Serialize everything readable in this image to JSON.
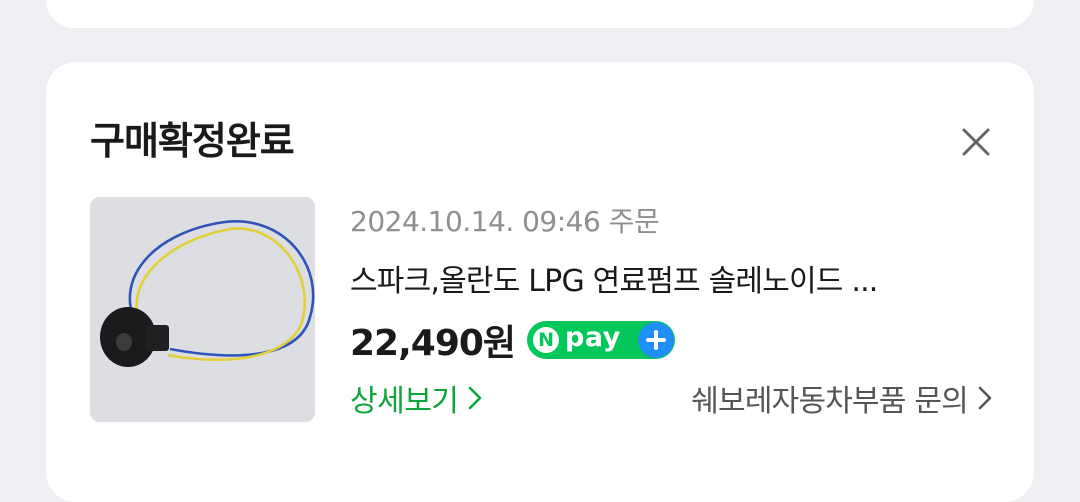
{
  "card": {
    "title": "구매확정완료",
    "close_icon": "close-icon",
    "order": {
      "date_text": "2024.10.14. 09:46 주문",
      "product_name": "스파크,올란도 LPG 연료펌프 솔레노이드 ...",
      "product_image": "solenoid-coil-with-wires",
      "price": "22,490원",
      "npay_badge": {
        "n_letter": "N",
        "label": "pay",
        "plus_icon": "plus-icon",
        "colors": {
          "green": "#03c75a",
          "blue": "#1e8ff7"
        }
      }
    },
    "actions": {
      "detail_label": "상세보기",
      "inquiry_label": "쉐보레자동차부품 문의"
    }
  },
  "colors": {
    "background": "#eef0f3",
    "card": "#ffffff",
    "accent_green": "#10a53b",
    "muted_text": "#8f8f8f"
  }
}
